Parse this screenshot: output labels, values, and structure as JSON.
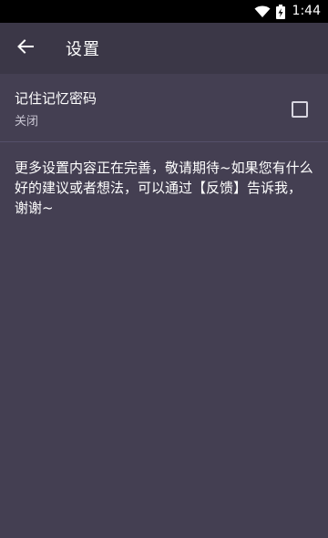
{
  "status_bar": {
    "time": "1:44",
    "icons": [
      "wifi-icon",
      "battery-charging-icon"
    ]
  },
  "toolbar": {
    "back_icon": "arrow-left-icon",
    "title": "设置"
  },
  "preferences": [
    {
      "title": "记住记忆密码",
      "summary": "关闭",
      "checked": false
    }
  ],
  "info_text": "更多设置内容正在完善，敬请期待~如果您有什么好的建议或者想法，可以通过【反馈】告诉我，谢谢~",
  "colors": {
    "background": "#443f52",
    "toolbar": "#3b3747",
    "status_bar": "#000000"
  }
}
